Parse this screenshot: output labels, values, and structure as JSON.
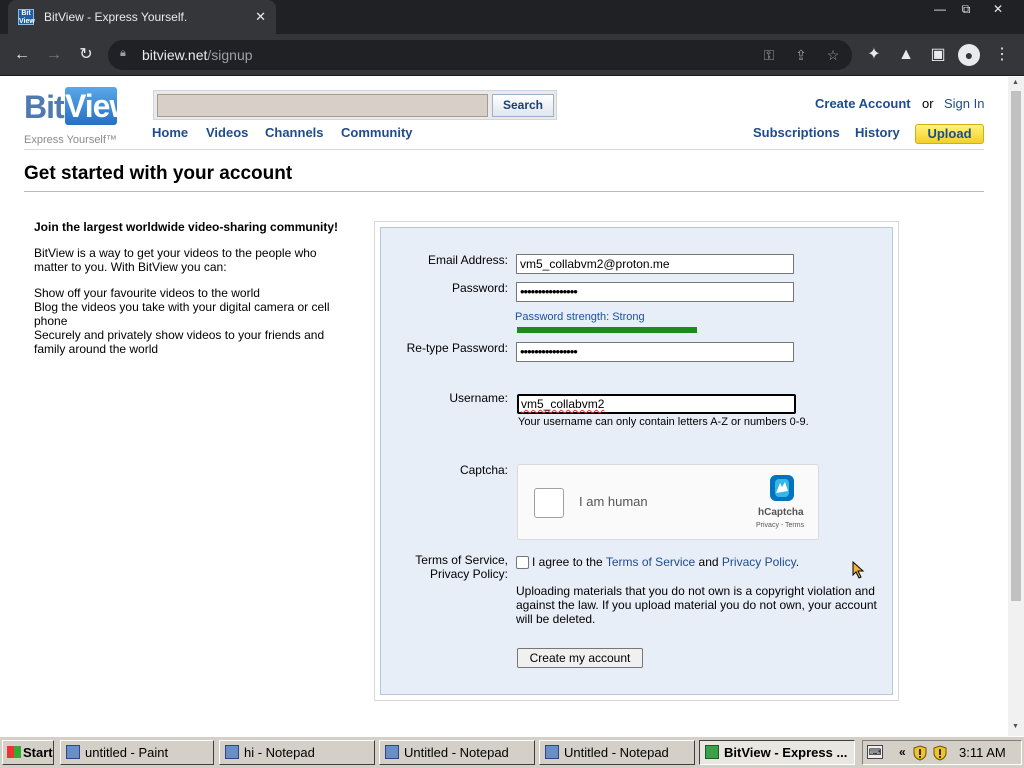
{
  "browser": {
    "tab_title": "BitView - Express Yourself.",
    "tab_favicon_text": "Bit View",
    "url_host": "bitview.net",
    "url_path": "/signup",
    "window_controls": {
      "minimize": "—",
      "restore": "⧉",
      "close": "✕"
    }
  },
  "header": {
    "logo_bit": "Bit",
    "logo_view": "View",
    "tagline": "Express Yourself™",
    "search_value": "",
    "search_button": "Search",
    "nav": [
      "Home",
      "Videos",
      "Channels",
      "Community"
    ],
    "create_account": "Create Account",
    "or": "or",
    "sign_in": "Sign In",
    "subscriptions": "Subscriptions",
    "history": "History",
    "upload": "Upload"
  },
  "page_title": "Get started with your account",
  "intro": {
    "heading": "Join the largest worldwide video-sharing community!",
    "paragraph": "BitView is a way to get your videos to the people who matter to you. With BitView you can:",
    "items": [
      "Show off your favourite videos to the world",
      "Blog the videos you take with your digital camera or cell phone",
      "Securely and privately show videos to your friends and family around the world"
    ]
  },
  "form": {
    "email_label": "Email Address:",
    "email_value": "vm5_collabvm2@proton.me",
    "password_label": "Password:",
    "password_value": "••••••••••••••••",
    "strength_text": "Password strength: Strong",
    "strength_level": 1.0,
    "retype_label": "Re-type Password:",
    "retype_value": "••••••••••••••••",
    "username_label": "Username:",
    "username_value": "vm5_collabvm2",
    "username_hint": "Your username can only contain letters A-Z or numbers 0-9.",
    "captcha_label": "Captcha:",
    "captcha_text": "I am human",
    "captcha_brand": "hCaptcha",
    "captcha_links": "Privacy - Terms",
    "tos_label_1": "Terms of Service,",
    "tos_label_2": "Privacy Policy:",
    "tos_prefix": "I agree to the",
    "tos_link": "Terms of Service",
    "tos_and": "and",
    "privacy_link": "Privacy Policy",
    "tos_period": ".",
    "warning": "Uploading materials that you do not own is a copyright violation and against the law. If you upload material you do not own, your account will be deleted.",
    "submit": "Create my account"
  },
  "taskbar": {
    "start": "Start",
    "tasks": [
      "untitled - Paint",
      "hi - Notepad",
      "Untitled - Notepad",
      "Untitled - Notepad",
      "BitView - Express ..."
    ],
    "tray_arrow": "«",
    "clock": "3:11 AM"
  },
  "colors": {
    "link_blue": "#1f4c8c",
    "strength_green": "#1e8a1e",
    "upload_yellow": "#f4cf2a",
    "form_bg": "#e8eef8"
  }
}
